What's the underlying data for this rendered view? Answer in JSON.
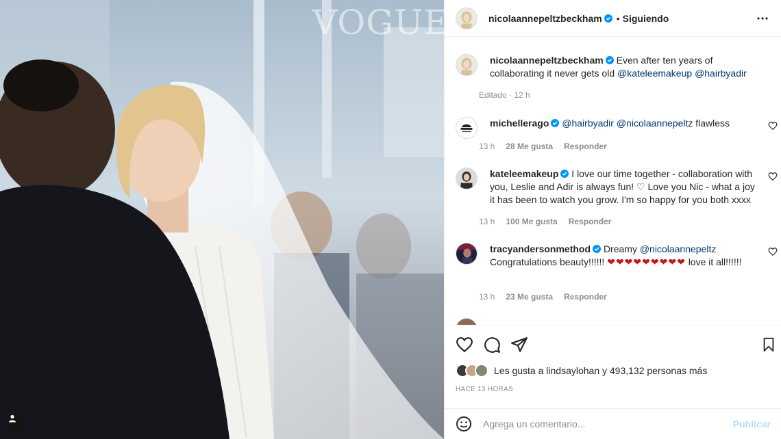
{
  "photo": {
    "watermark": "VOGUE"
  },
  "header": {
    "username": "nicolaannepeltzbeckham",
    "separator": "•",
    "follow_status": "Siguiendo"
  },
  "caption": {
    "username": "nicolaannepeltzbeckham",
    "text": "Even after ten years of collaborating it never gets old",
    "mentions": [
      "@kateleemakeup",
      "@hairbyadir"
    ],
    "meta": "Editado · 12 h"
  },
  "comments": [
    {
      "username": "michellerago",
      "verified": true,
      "mentions": [
        "@hairbyadir",
        "@nicolaannepeltz"
      ],
      "text": "flawless",
      "time": "13 h",
      "likes": "28 Me gusta",
      "reply": "Responder"
    },
    {
      "username": "kateleemakeup",
      "verified": true,
      "text": "I love our time together - collaboration with you, Leslie and Adir is always fun! ♡ Love you Nic - what a joy it has been to watch you grow. I'm so happy for you both xxxx",
      "time": "13 h",
      "likes": "100 Me gusta",
      "reply": "Responder"
    },
    {
      "username": "tracyandersonmethod",
      "verified": true,
      "text_before": "Dreamy",
      "mention": "@nicolaannepeltz",
      "text_after": "Congratulations beauty!!!!!!",
      "emoji": "❤❤❤❤❤❤❤❤❤",
      "text_end": "love it all!!!!!!",
      "time": "13 h",
      "likes": "23 Me gusta",
      "reply": "Responder"
    }
  ],
  "likes": {
    "text": "Les gusta a lindsaylohan y 493,132 personas más"
  },
  "time_ago": "HACE 13 HORAS",
  "composer": {
    "placeholder": "Agrega un comentario...",
    "publish_label": "Publicar"
  },
  "colors": {
    "verified_blue": "#0095f6",
    "mention_blue": "#00376b",
    "publish_disabled": "#b2dffc",
    "heart_red": "#c0151d"
  },
  "icons": {
    "like": "heart-icon",
    "comment": "comment-icon",
    "share": "send-icon",
    "save": "bookmark-icon",
    "options": "more-icon",
    "emoji": "emoji-icon",
    "tag": "user-tag-icon"
  }
}
